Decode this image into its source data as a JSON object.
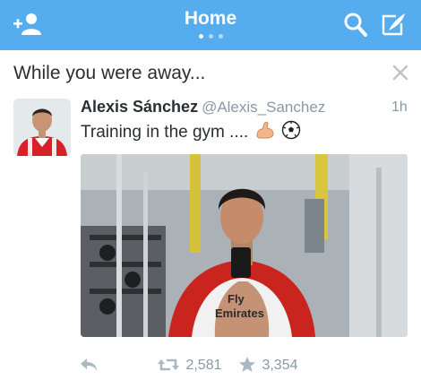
{
  "header": {
    "title": "Home",
    "page_count": 3,
    "active_page": 0,
    "icons": {
      "left": "add-user-icon",
      "search": "search-icon",
      "compose": "compose-tweet-icon"
    }
  },
  "section": {
    "title": "While you were away...",
    "dismiss_icon": "close-icon"
  },
  "tweet": {
    "name": "Alexis Sánchez",
    "handle": "@Alexis_Sanchez",
    "time": "1h",
    "text": "Training in the gym ....",
    "emoji": [
      "flexed-biceps-emoji",
      "soccer-ball-emoji"
    ],
    "retweets": "2,581",
    "favorites": "3,354"
  },
  "colors": {
    "brand": "#55acee",
    "text": "#292f33",
    "muted": "#8899a6"
  }
}
